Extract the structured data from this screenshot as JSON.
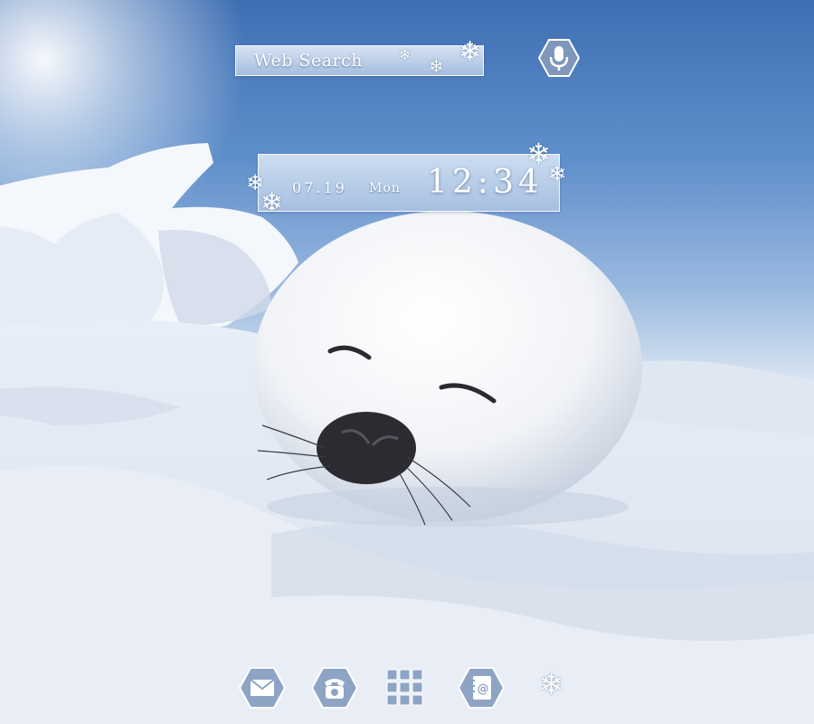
{
  "search": {
    "label": "Web Search"
  },
  "clock": {
    "date": "07.19",
    "day": "Mon",
    "time": "12:34"
  },
  "icons": {
    "mic": "microphone-icon",
    "mail": "mail-icon",
    "phone": "phone-icon",
    "apps": "app-drawer-icon",
    "contacts": "contacts-icon",
    "theme": "snowflake-icon"
  },
  "colors": {
    "sky": "#4a7abb",
    "snow": "#eef2f8",
    "widget_glass": "#d4e0f0"
  }
}
